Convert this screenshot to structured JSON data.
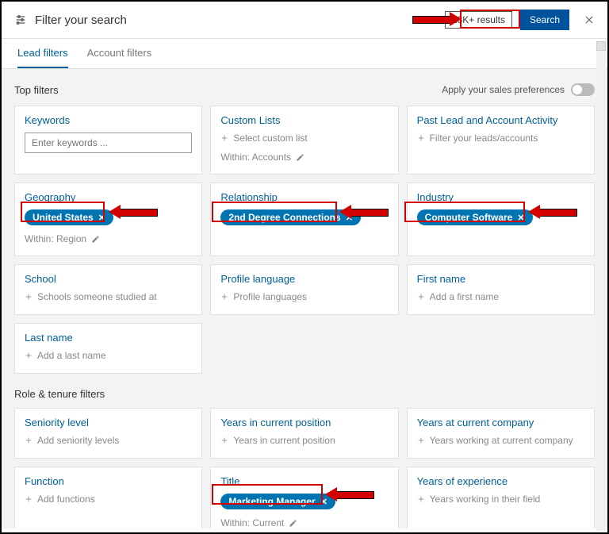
{
  "header": {
    "title": "Filter your search",
    "results": "13K+ results",
    "search_label": "Search"
  },
  "tabs": {
    "lead": "Lead filters",
    "account": "Account filters"
  },
  "top_section": {
    "title": "Top filters",
    "prefs_label": "Apply your sales preferences"
  },
  "cards": {
    "keywords": {
      "title": "Keywords",
      "placeholder": "Enter keywords ..."
    },
    "customlists": {
      "title": "Custom Lists",
      "add": "Select custom list",
      "within": "Within: Accounts"
    },
    "pastlead": {
      "title": "Past Lead and Account Activity",
      "add": "Filter your leads/accounts"
    },
    "geography": {
      "title": "Geography",
      "chip": "United States",
      "within": "Within: Region"
    },
    "relationship": {
      "title": "Relationship",
      "chip": "2nd Degree Connections"
    },
    "industry": {
      "title": "Industry",
      "chip": "Computer Software"
    },
    "school": {
      "title": "School",
      "add": "Schools someone studied at"
    },
    "profilelang": {
      "title": "Profile language",
      "add": "Profile languages"
    },
    "firstname": {
      "title": "First name",
      "add": "Add a first name"
    },
    "lastname": {
      "title": "Last name",
      "add": "Add a last name"
    }
  },
  "role_section": {
    "title": "Role & tenure filters"
  },
  "role_cards": {
    "seniority": {
      "title": "Seniority level",
      "add": "Add seniority levels"
    },
    "yearspos": {
      "title": "Years in current position",
      "add": "Years in current position"
    },
    "yearscomp": {
      "title": "Years at current company",
      "add": "Years working at current company"
    },
    "function": {
      "title": "Function",
      "add": "Add functions"
    },
    "title": {
      "title": "Title",
      "chip": "Marketing Manager",
      "within": "Within: Current"
    },
    "yearsexp": {
      "title": "Years of experience",
      "add": "Years working in their field"
    }
  }
}
